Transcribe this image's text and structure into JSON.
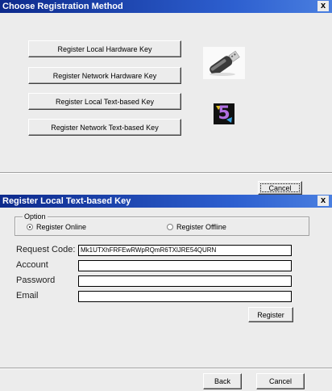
{
  "window1": {
    "title": "Choose Registration Method",
    "close_glyph": "x",
    "buttons": {
      "local_hardware": "Register Local Hardware Key",
      "network_hardware": "Register Network Hardware Key",
      "local_text": "Register Local Text-based Key",
      "network_text": "Register Network Text-based Key",
      "cancel": "Cancel"
    },
    "images": {
      "usb_icon": "usb-drive-icon",
      "logo_icon": "five-logo-icon",
      "logo_char": "5"
    }
  },
  "window2": {
    "title": "Register Local Text-based Key",
    "close_glyph": "x",
    "option_legend": "Option",
    "radio_online": "Register Online",
    "radio_offline": "Register Offline",
    "selected_option": "online",
    "labels": {
      "request_code": "Request Code:",
      "account": "Account",
      "password": "Password",
      "email": "Email"
    },
    "values": {
      "request_code": "Mk1UTXhFRFEwRWpRQmR6TXlJRE54QURN",
      "account": "",
      "password": "",
      "email": ""
    },
    "buttons": {
      "register": "Register",
      "back": "Back",
      "cancel": "Cancel"
    }
  }
}
